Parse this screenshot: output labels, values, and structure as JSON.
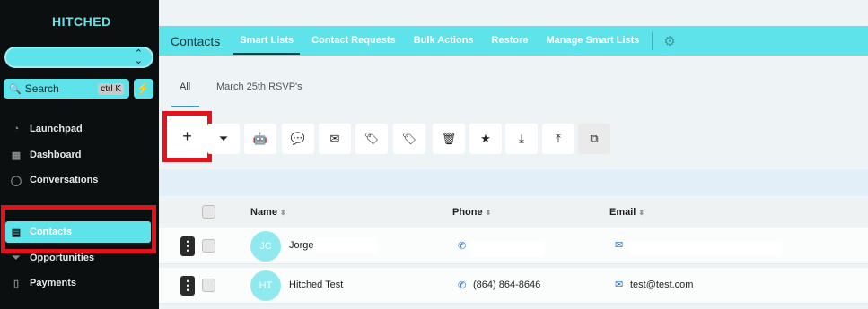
{
  "sidebar": {
    "brand": "HITCHED",
    "account_chevron": "⌃⌄",
    "search": {
      "label": "Search",
      "shortcut": "ctrl K"
    },
    "nav": [
      {
        "label": "Launchpad",
        "icon": "rocket-icon"
      },
      {
        "label": "Dashboard",
        "icon": "grid-icon"
      },
      {
        "label": "Conversations",
        "icon": "chat-icon"
      },
      {
        "label": "Contacts",
        "icon": "contact-card-icon",
        "active": true
      },
      {
        "label": "Opportunities",
        "icon": "funnel-icon"
      },
      {
        "label": "Payments",
        "icon": "receipt-icon"
      }
    ]
  },
  "topbar": {
    "title": "Contacts",
    "tabs": [
      {
        "label": "Smart Lists",
        "active": true
      },
      {
        "label": "Contact Requests"
      },
      {
        "label": "Bulk Actions"
      },
      {
        "label": "Restore"
      },
      {
        "label": "Manage Smart Lists"
      }
    ]
  },
  "subtabs": {
    "all": "All",
    "rsvp": "March 25th RSVP's"
  },
  "toolbar": {
    "add": "+",
    "buttons": [
      {
        "icon": "filter-icon",
        "glyph": "⏷"
      },
      {
        "icon": "robot-icon",
        "glyph": "🤖"
      },
      {
        "icon": "message-icon",
        "glyph": "💬"
      },
      {
        "icon": "email-icon",
        "glyph": "✉"
      },
      {
        "icon": "tag-add-icon",
        "glyph": "🏷"
      },
      {
        "icon": "tag-remove-icon",
        "glyph": "🏷"
      },
      {
        "icon": "trash-icon",
        "glyph": "🗑"
      },
      {
        "icon": "star-icon",
        "glyph": "★"
      },
      {
        "icon": "import-icon",
        "glyph": "⤓"
      },
      {
        "icon": "export-icon",
        "glyph": "⤒"
      },
      {
        "icon": "merge-icon",
        "glyph": "⧉"
      }
    ]
  },
  "table": {
    "columns": {
      "name": "Name",
      "phone": "Phone",
      "email": "Email"
    },
    "rows": [
      {
        "initials": "JC",
        "name": "Jorge",
        "phone": "",
        "email": ""
      },
      {
        "initials": "HT",
        "name": "Hitched Test",
        "phone": "(864) 864-8646",
        "email": "test@test.com"
      }
    ]
  },
  "colors": {
    "accent": "#5fe3ea",
    "sidebar": "#0b0f10",
    "highlight": "#e3131c",
    "link": "#1f6fc4"
  }
}
